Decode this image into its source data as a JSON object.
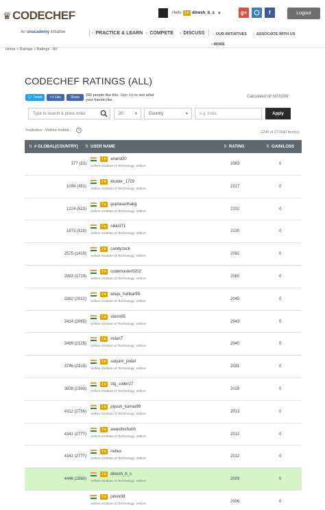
{
  "header": {
    "logo": "CODECHEF",
    "tagline_prefix": "An",
    "tagline_brand": "unacademy",
    "tagline_suffix": "initiative",
    "hello": "Hello",
    "star": "1★",
    "username": "dinesh_b_s",
    "logout": "Logout",
    "nav": [
      "PRACTICE & LEARN",
      "COMPETE",
      "DISCUSS"
    ],
    "nav_small": [
      "OUR INITIATIVES",
      "ASSOCIATE WITH US"
    ],
    "nav_more": "MORE",
    "social": [
      "g+",
      "gh",
      "f"
    ]
  },
  "breadcrumb": [
    "Home",
    "Ratings",
    "Ratings - All"
  ],
  "page_title": "CODECHEF RATINGS (ALL)",
  "share": {
    "tweet": "Tweet",
    "like": "Like",
    "share": "Share",
    "likes_text": "282 people like this.",
    "signup_text": "Sign Up",
    "likes_suffix": "to see what your friends like."
  },
  "calculated": "Calculated till NOV208",
  "filters": {
    "search_placeholder": "Type to search & press enter",
    "per_page": "20",
    "country": "Country",
    "country_placeholder": "e.g. India",
    "apply": "Apply",
    "active_filter": "Institution : Vellore Institut..."
  },
  "item_count": "2249 of 277642 item(s)",
  "table": {
    "headers": [
      "# GLOBAL(COUNTRY)",
      "USER NAME",
      "RATING",
      "GAIN/LOSS"
    ],
    "institution": "Vellore Institute of Technology, Vellore",
    "rows": [
      {
        "rank": "377 (83)",
        "user": "anand20",
        "rating": "2363",
        "gain": "0"
      },
      {
        "rank": "1098 (451)",
        "user": "kkoder_1729",
        "rating": "2217",
        "gain": "0"
      },
      {
        "rank": "1224 (523)",
        "user": "guptasarthakg",
        "rating": "2202",
        "gain": "0"
      },
      {
        "rank": "1873 (919)",
        "user": "nikki371",
        "rating": "2130",
        "gain": "0"
      },
      {
        "rank": "2575 (1419)",
        "user": "candyzack",
        "rating": "2081",
        "gain": "0"
      },
      {
        "rank": "2983 (1719)",
        "user": "codemaster0202",
        "rating": "2060",
        "gain": "0"
      },
      {
        "rank": "3362 (2022)",
        "user": "anujs_harikar95",
        "rating": "2045",
        "gain": "0"
      },
      {
        "rank": "3414 (2065)",
        "user": "storm95",
        "rating": "2043",
        "gain": "0"
      },
      {
        "rank": "3489 (2125)",
        "user": "milan7",
        "rating": "2040",
        "gain": "0"
      },
      {
        "rank": "3746 (2319)",
        "user": "satyam_jindal",
        "rating": "2031",
        "gain": "0"
      },
      {
        "rank": "3838 (2393)",
        "user": "stg_coder27",
        "rating": "2028",
        "gain": "0"
      },
      {
        "rank": "4312 (2756)",
        "user": "piyush_kumar99",
        "rating": "2013",
        "gain": "0"
      },
      {
        "rank": "4341 (2777)",
        "user": "awasthishubh",
        "rating": "2012",
        "gain": "0"
      },
      {
        "rank": "4341 (2777)",
        "user": "nellex",
        "rating": "2012",
        "gain": "0"
      },
      {
        "rank": "4446 (2860)",
        "user": "dinesh_b_s",
        "rating": "2009",
        "gain": "0",
        "highlight": true
      },
      {
        "rank": "",
        "user": "junior08",
        "rating": "2006",
        "gain": "0"
      }
    ]
  },
  "colors": {
    "highlight_row": "#d5f5c9",
    "table_header": "#5f666c",
    "star_badge": "#e0a400"
  }
}
